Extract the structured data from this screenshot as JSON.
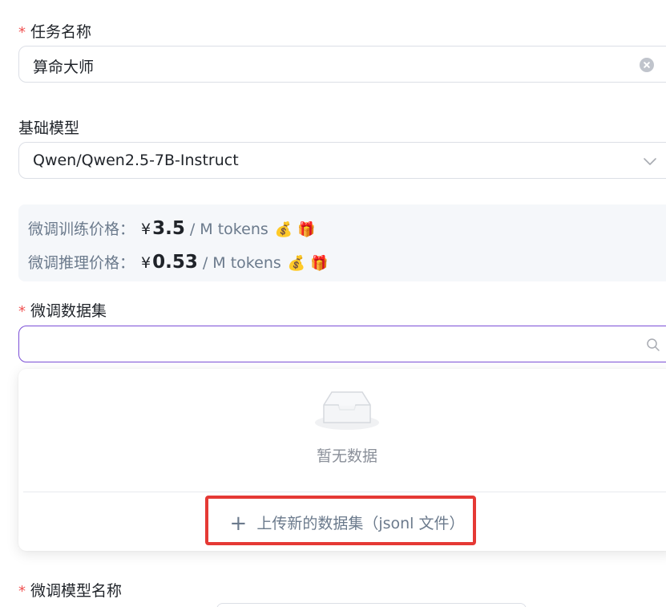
{
  "task_name": {
    "label": "任务名称",
    "required_mark": "*",
    "value": "算命大师"
  },
  "base_model": {
    "label": "基础模型",
    "value": "Qwen/Qwen2.5-7B-Instruct"
  },
  "pricing": {
    "training": {
      "label": "微调训练价格：",
      "currency": "¥",
      "amount": "3.5",
      "unit": "/ M tokens",
      "emoji_money": "💰",
      "emoji_gift": "🎁"
    },
    "inference": {
      "label": "微调推理价格：",
      "currency": "¥",
      "amount": "0.53",
      "unit": "/ M tokens",
      "emoji_money": "💰",
      "emoji_gift": "🎁"
    }
  },
  "dataset": {
    "label": "微调数据集",
    "required_mark": "*",
    "value": "",
    "empty_text": "暂无数据",
    "upload_plus": "+",
    "upload_label": "上传新的数据集（jsonl 文件）"
  },
  "finetune_model_name": {
    "label": "微调模型名称",
    "required_mark": "*"
  },
  "colors": {
    "accent_purple": "#7b4fd6",
    "required_red": "#f05252",
    "highlight_red": "#e53935"
  },
  "icons": {
    "clear": "clear-icon",
    "chevron": "chevron-down-icon",
    "search": "search-icon",
    "empty": "empty-inbox-icon",
    "plus": "plus-icon"
  }
}
